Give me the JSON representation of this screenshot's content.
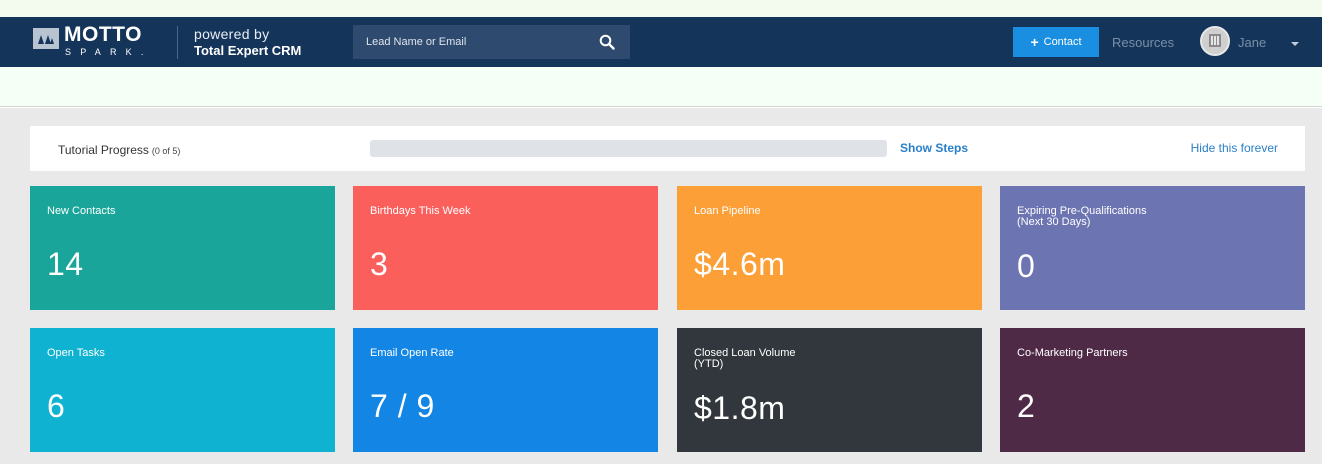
{
  "navbar": {
    "logo_word": "MOTTO",
    "logo_sub": "SPARK.",
    "powered_line1": "powered by",
    "powered_line2": "Total Expert CRM",
    "search_placeholder": "Lead Name or Email",
    "contact_button": "Contact",
    "resources_link": "Resources",
    "user_name": "Jane",
    "colors": {
      "bg": "#14345a",
      "accent": "#1a8ee0"
    }
  },
  "tutorial": {
    "label": "Tutorial Progress",
    "count": "(0 of 5)",
    "progress": 0,
    "show_steps": "Show Steps",
    "hide_forever": "Hide this forever"
  },
  "cards": [
    {
      "title": "New Contacts",
      "value": "14",
      "color": "#1aa59a"
    },
    {
      "title": "Birthdays This Week",
      "value": "3",
      "color": "#fb5f5c"
    },
    {
      "title": "Loan Pipeline",
      "value": "$4.6m",
      "color": "#fc9f36"
    },
    {
      "title": "Expiring Pre-Qualifications\n(Next 30 Days)",
      "value": "0",
      "color": "#6c74b1"
    },
    {
      "title": "Open Tasks",
      "value": "6",
      "color": "#0fb3d1"
    },
    {
      "title": "Email Open Rate",
      "value": "7 / 9",
      "color": "#1285e5"
    },
    {
      "title": "Closed Loan Volume\n(YTD)",
      "value": "$1.8m",
      "color": "#31373c"
    },
    {
      "title": "Co-Marketing Partners",
      "value": "2",
      "color": "#4f2a47"
    }
  ]
}
